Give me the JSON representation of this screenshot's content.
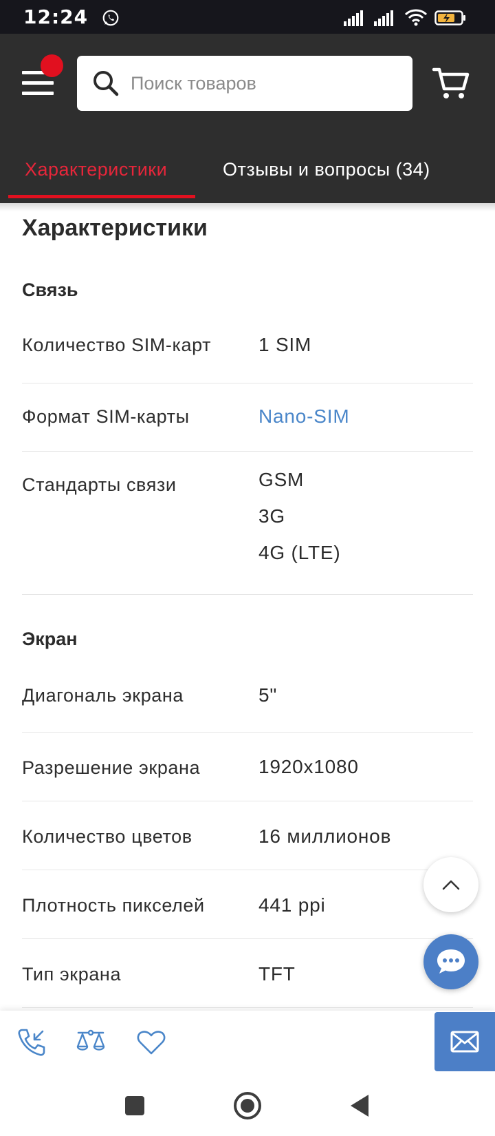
{
  "status_bar": {
    "time": "12:24"
  },
  "header": {
    "search": {
      "placeholder": "Поиск товаров",
      "value": ""
    },
    "tabs": [
      {
        "label": "Характеристики",
        "active": true
      },
      {
        "label": "Отзывы и вопросы (34)",
        "active": false
      }
    ],
    "accent_color": "#e1101f"
  },
  "specs": {
    "title": "Характеристики",
    "sections": [
      {
        "title": "Связь",
        "rows": [
          {
            "label": "Количество SIM-карт",
            "values": [
              "1 SIM"
            ]
          },
          {
            "label": "Формат SIM-карты",
            "values": [
              "Nano-SIM"
            ],
            "link": true
          },
          {
            "label": "Стандарты связи",
            "values": [
              "GSM",
              "3G",
              "4G (LTE)"
            ]
          }
        ]
      },
      {
        "title": "Экран",
        "rows": [
          {
            "label": "Диагональ экрана",
            "values": [
              "5\""
            ]
          },
          {
            "label": "Разрешение экрана",
            "values": [
              "1920x1080"
            ]
          },
          {
            "label": "Количество цветов",
            "values": [
              "16 миллионов"
            ]
          },
          {
            "label": "Плотность пикселей",
            "values": [
              "441 ppi"
            ]
          },
          {
            "label": "Тип экрана",
            "values": [
              "TFT"
            ]
          }
        ]
      }
    ]
  },
  "colors": {
    "link": "#4a86c9",
    "chat_button": "#4c7fc7",
    "header_bg": "#2e2e2e"
  }
}
